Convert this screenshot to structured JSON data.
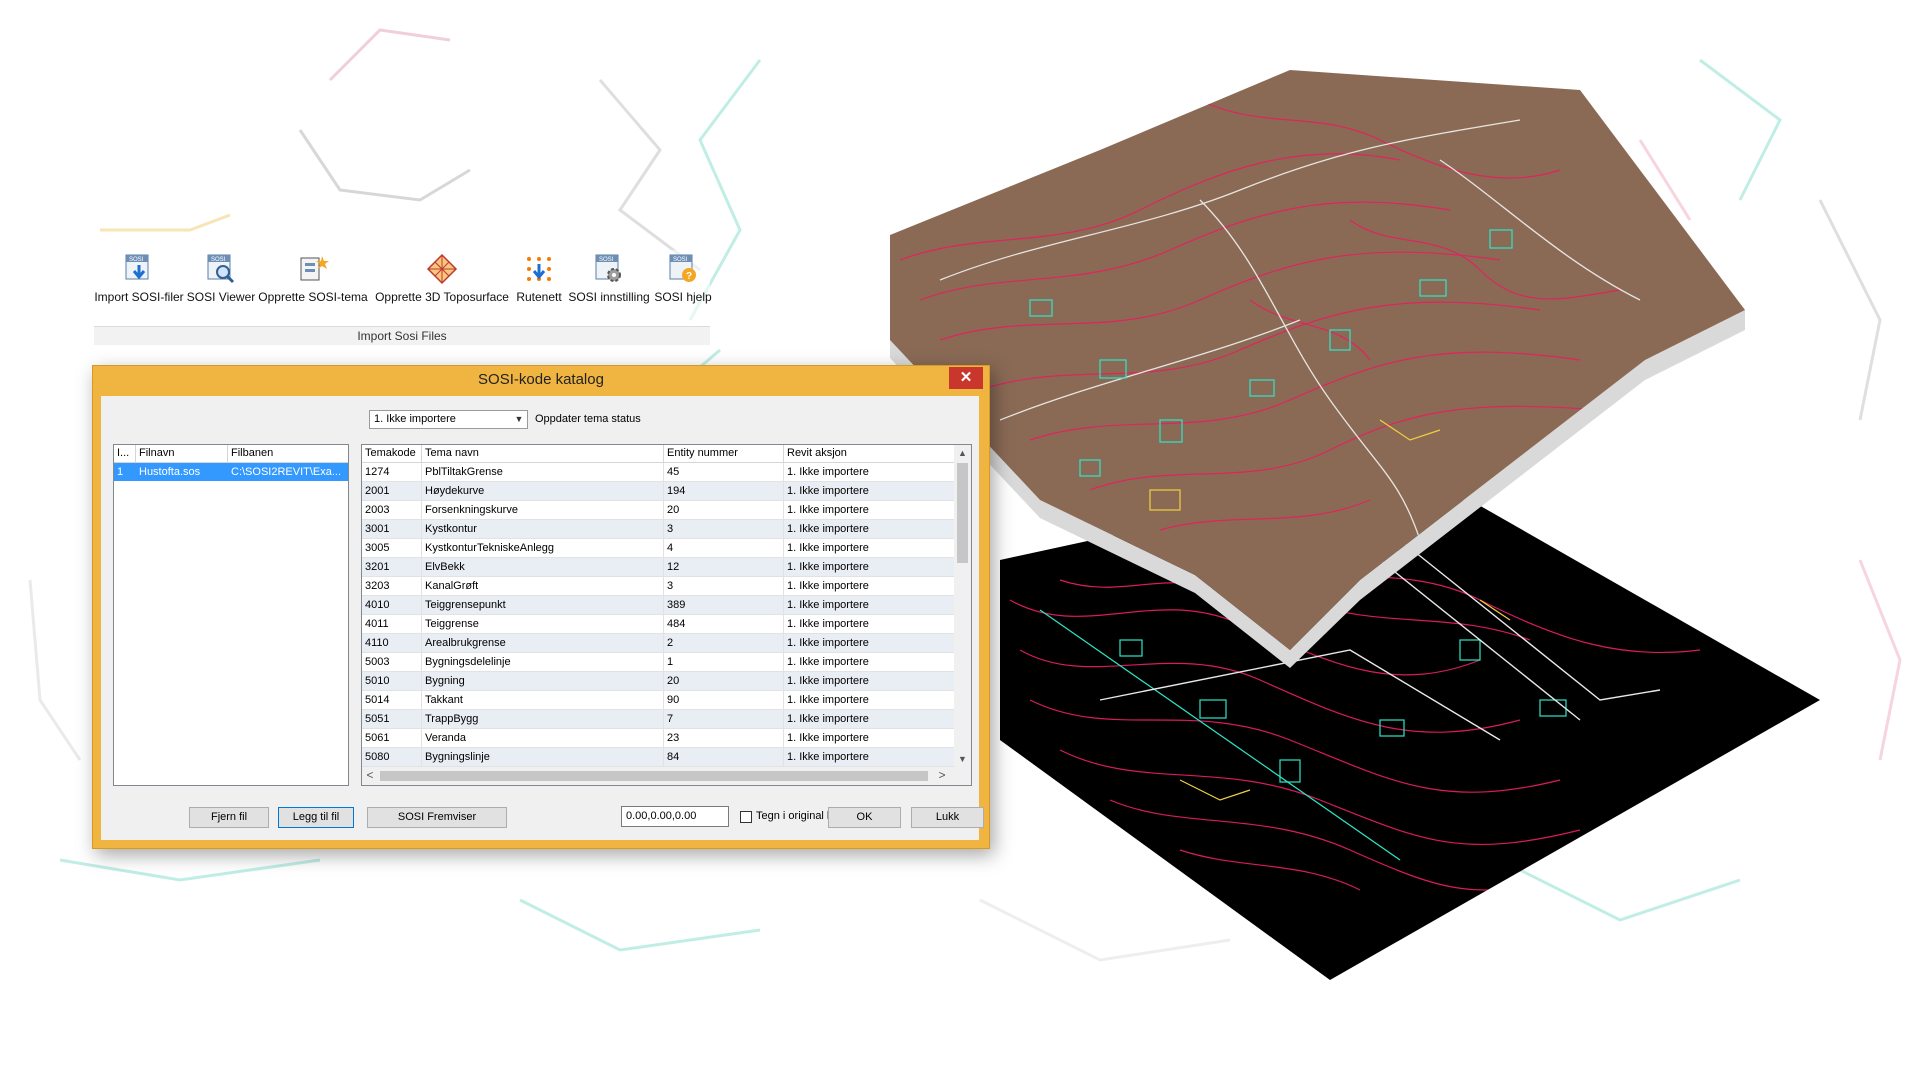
{
  "ribbon": {
    "buttons": [
      {
        "label": "Import SOSI-filer",
        "icon": "sosi-import-icon"
      },
      {
        "label": "SOSI Viewer",
        "icon": "sosi-viewer-icon"
      },
      {
        "label": "Opprette SOSI-tema",
        "icon": "create-theme-icon"
      },
      {
        "label": "Opprette 3D Toposurface",
        "icon": "toposurface-icon"
      },
      {
        "label": "Rutenett",
        "icon": "grid-icon"
      },
      {
        "label": "SOSI innstilling",
        "icon": "sosi-settings-icon"
      },
      {
        "label": "SOSI hjelp",
        "icon": "sosi-help-icon"
      }
    ],
    "group_label": "Import Sosi Files"
  },
  "dialog": {
    "title": "SOSI-kode katalog",
    "close": "✕",
    "status_select": {
      "value": "1. Ikke importere",
      "arrow": "▼"
    },
    "status_label": "Oppdater tema status",
    "file_list": {
      "headers": [
        "I...",
        "Filnavn",
        "Filbanen"
      ],
      "rows": [
        {
          "index": "1",
          "filnavn": "Hustofta.sos",
          "filbanen": "C:\\SOSI2REVIT\\Exa..."
        }
      ]
    },
    "tema_table": {
      "headers": [
        "Temakode",
        "Tema navn",
        "Entity nummer",
        "Revit aksjon"
      ],
      "rows": [
        [
          "1274",
          "PblTiltakGrense",
          "45",
          "1. Ikke importere"
        ],
        [
          "2001",
          "Høydekurve",
          "194",
          "1. Ikke importere"
        ],
        [
          "2003",
          "Forsenkningskurve",
          "20",
          "1. Ikke importere"
        ],
        [
          "3001",
          "Kystkontur",
          "3",
          "1. Ikke importere"
        ],
        [
          "3005",
          "KystkonturTekniskeAnlegg",
          "4",
          "1. Ikke importere"
        ],
        [
          "3201",
          "ElvBekk",
          "12",
          "1. Ikke importere"
        ],
        [
          "3203",
          "KanalGrøft",
          "3",
          "1. Ikke importere"
        ],
        [
          "4010",
          "Teiggrensepunkt",
          "389",
          "1. Ikke importere"
        ],
        [
          "4011",
          "Teiggrense",
          "484",
          "1. Ikke importere"
        ],
        [
          "4110",
          "Arealbrukgrense",
          "2",
          "1. Ikke importere"
        ],
        [
          "5003",
          "Bygningsdelelinje",
          "1",
          "1. Ikke importere"
        ],
        [
          "5010",
          "Bygning",
          "20",
          "1. Ikke importere"
        ],
        [
          "5014",
          "Takkant",
          "90",
          "1. Ikke importere"
        ],
        [
          "5051",
          "TrappBygg",
          "7",
          "1. Ikke importere"
        ],
        [
          "5061",
          "Veranda",
          "23",
          "1. Ikke importere"
        ],
        [
          "5080",
          "Bygningslinje",
          "84",
          "1. Ikke importere"
        ]
      ]
    },
    "scroll": {
      "up": "▲",
      "down": "▼",
      "left": "<",
      "right": ">"
    },
    "buttons": {
      "remove_file": "Fjern fil",
      "add_file": "Legg til fil",
      "viewer": "SOSI Fremviser",
      "ok": "OK",
      "close": "Lukk"
    },
    "coord_input": "0.00,0.00,0.00",
    "checkbox_label": "Tegn i original koordinater"
  },
  "colors": {
    "dialog_frame": "#f0b541",
    "selection": "#3399ff",
    "terrain": "#8a6a55",
    "contour": "#e0245e",
    "cad_background": "#000000"
  }
}
